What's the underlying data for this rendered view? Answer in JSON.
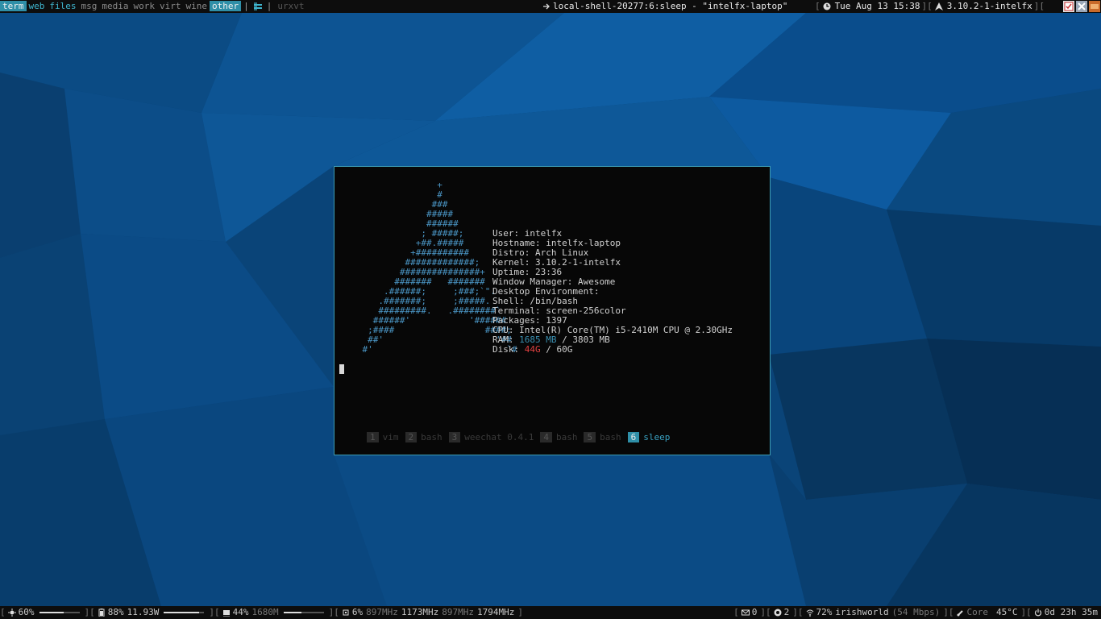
{
  "topbar": {
    "tags": [
      {
        "label": "term",
        "state": "active"
      },
      {
        "label": "web",
        "state": "occ"
      },
      {
        "label": "files",
        "state": "occ"
      },
      {
        "label": "msg",
        "state": ""
      },
      {
        "label": "media",
        "state": ""
      },
      {
        "label": "work",
        "state": ""
      },
      {
        "label": "virt",
        "state": ""
      },
      {
        "label": "wine",
        "state": ""
      },
      {
        "label": "other",
        "state": "active"
      }
    ],
    "pipe": "|",
    "tasklist": "urxvt",
    "window_title": "local-shell-20277:6:sleep - \"intelfx-laptop\"",
    "clock": "Tue Aug 13 15:38",
    "kernel": "3.10.2-1-intelfx",
    "bracket_open": "[",
    "bracket_mid": "][",
    "bracket_close": "]["
  },
  "terminal": {
    "art": [
      "                  +",
      "                  #",
      "                 ###",
      "                #####",
      "                ######",
      "               ; #####;",
      "              +##.#####",
      "             +##########",
      "            #############;",
      "           ###############+",
      "          #######   #######",
      "        .######;     ;###;`\".",
      "       .#######;     ;#####.",
      "       #########.   .########`",
      "      ######'           '######",
      "     ;####                 ####;",
      "     ##'                     '##",
      "    #'                         `#"
    ],
    "info": {
      "user_label": "User:",
      "user": "intelfx",
      "host_label": "Hostname:",
      "host": "intelfx-laptop",
      "distro_label": "Distro:",
      "distro": "Arch Linux",
      "kernel_label": "Kernel:",
      "kernel": "3.10.2-1-intelfx",
      "uptime_label": "Uptime:",
      "uptime": "23:36",
      "wm_label": "Window Manager:",
      "wm": "Awesome",
      "de_label": "Desktop Environment:",
      "shell_label": "Shell:",
      "shell": "/bin/bash",
      "term_label": "Terminal:",
      "term": "screen-256color",
      "pkg_label": "Packages:",
      "pkg": "1397",
      "cpu_label": "CPU:",
      "cpu": "Intel(R) Core(TM) i5-2410M CPU @ 2.30GHz",
      "ram_label": "RAM:",
      "ram_used": "1685 MB",
      "ram_sep": "/",
      "ram_total": "3803 MB",
      "disk_label": "Disk:",
      "disk_used": "44G",
      "disk_sep": "/",
      "disk_total": "60G"
    },
    "windows": [
      {
        "num": "1",
        "name": "vim"
      },
      {
        "num": "2",
        "name": "bash"
      },
      {
        "num": "3",
        "name": "weechat 0.4.1"
      },
      {
        "num": "4",
        "name": "bash"
      },
      {
        "num": "5",
        "name": "bash"
      },
      {
        "num": "6",
        "name": "sleep"
      }
    ]
  },
  "botbar": {
    "brightness": "60%",
    "brightness_level": 0.6,
    "battery": "88%",
    "power": "11.93W",
    "battery_level": 0.88,
    "mem": "44%",
    "mem_mb": "1680M",
    "mem_level": 0.44,
    "cpu": "6%",
    "freq1": "897MHz",
    "freq2": "1173MHz",
    "freq3": "897MHz",
    "freq4": "1794MHz",
    "mail": "0",
    "irc": "2",
    "wifi": "72%",
    "ssid": "irishworld",
    "rate": "(54 Mbps)",
    "temp_label": "Core",
    "temp": "45°C",
    "uptime": "0d 23h 35m",
    "bracket_open": "[",
    "bracket_mid": "][",
    "bracket_close": "]"
  },
  "colors": {
    "accent": "#2f8fa8",
    "border": "#3d9cb3",
    "bar": "#0d0d0d",
    "red": "#e04040",
    "blue": "#4a95c4"
  }
}
